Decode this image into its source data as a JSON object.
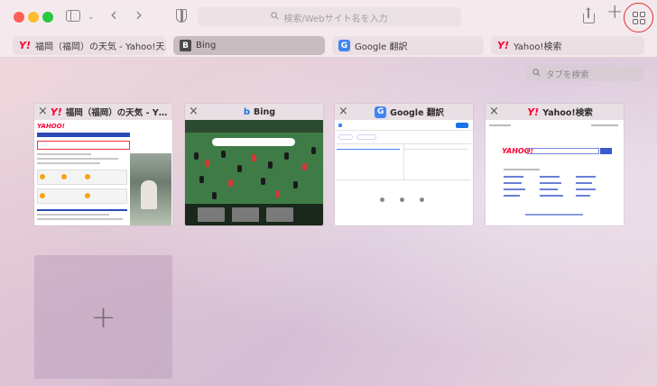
{
  "toolbar": {
    "address_placeholder": "検索/Webサイト名を入力"
  },
  "tabs": [
    {
      "title": "福岡（福岡）の天気 - Yahoo!天…",
      "favicon": "yahoo-favicon",
      "active": false
    },
    {
      "title": "Bing",
      "favicon": "bing-favicon",
      "active": true
    },
    {
      "title": "Google 翻訳",
      "favicon": "google-translate-favicon",
      "active": false
    },
    {
      "title": "Yahoo!検索",
      "favicon": "yahoo-favicon",
      "active": false
    }
  ],
  "overview": {
    "search_placeholder": "タブを検索",
    "cards": [
      {
        "title": "福岡（福岡）の天気 - Y…"
      },
      {
        "title": "Bing"
      },
      {
        "title": "Google 翻訳"
      },
      {
        "title": "Yahoo!検索"
      }
    ],
    "new_tab_symbol": "+"
  },
  "colors": {
    "highlight_ring": "#e42c2c",
    "yahoo_red": "#ff0033"
  }
}
